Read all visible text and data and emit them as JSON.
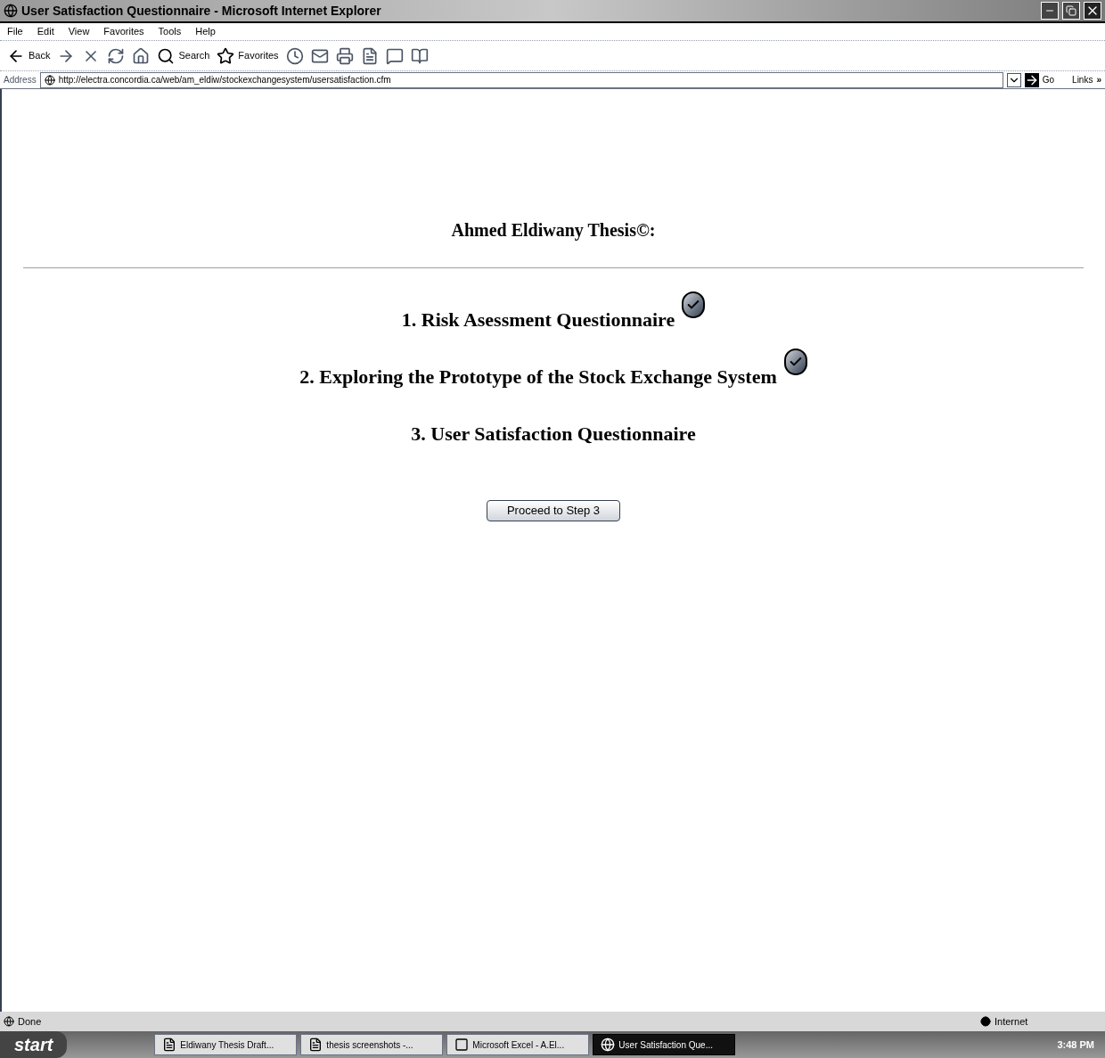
{
  "window": {
    "title": "User Satisfaction Questionnaire - Microsoft Internet Explorer"
  },
  "menu": [
    "File",
    "Edit",
    "View",
    "Favorites",
    "Tools",
    "Help"
  ],
  "toolbar": [
    {
      "kind": "back",
      "label": "Back"
    },
    {
      "kind": "forward"
    },
    {
      "kind": "stop"
    },
    {
      "kind": "refresh"
    },
    {
      "kind": "home"
    },
    {
      "kind": "search",
      "label": "Search"
    },
    {
      "kind": "favorites",
      "label": "Favorites"
    },
    {
      "kind": "history"
    },
    {
      "kind": "mail"
    },
    {
      "kind": "print"
    },
    {
      "kind": "edit"
    },
    {
      "kind": "discuss"
    },
    {
      "kind": "research"
    }
  ],
  "address": {
    "label": "Address",
    "value": "http://electra.concordia.ca/web/am_eldiw/stockexchangesystem/usersatisfaction.cfm",
    "go": "Go",
    "links": "Links",
    "more": "»"
  },
  "page": {
    "heading": "Ahmed Eldiwany Thesis©:",
    "steps": [
      {
        "label": "1. Risk Asessment Questionnaire",
        "completed": true
      },
      {
        "label": "2. Exploring the Prototype of the Stock Exchange System",
        "completed": true
      },
      {
        "label": "3. User Satisfaction Questionnaire",
        "completed": false
      }
    ],
    "button": "Proceed to Step 3"
  },
  "status_bar": {
    "status": "Done",
    "zone": "Internet"
  },
  "taskbar": {
    "start": "start",
    "items": [
      {
        "label": "Eldiwany Thesis Draft...",
        "kind": "word",
        "selected": false
      },
      {
        "label": "thesis screenshots -...",
        "kind": "word",
        "selected": false
      },
      {
        "label": "Microsoft Excel - A.El...",
        "kind": "excel",
        "selected": false
      },
      {
        "label": "User Satisfaction Que...",
        "kind": "ie",
        "selected": true
      }
    ],
    "clock": "3:48 PM"
  }
}
